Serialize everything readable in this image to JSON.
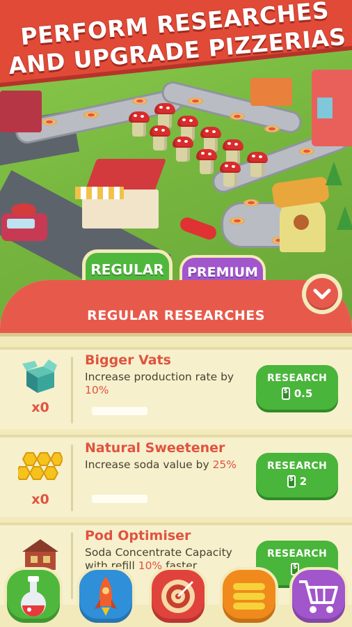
{
  "banner": {
    "line1": "PERFORM RESEARCHES",
    "line2": "AND UPGRADE PIZZERIAS"
  },
  "tabs": [
    {
      "label": "REGULAR",
      "color": "#4fb83c",
      "active": true
    },
    {
      "label": "PREMIUM",
      "color": "#a156cc",
      "active": false
    }
  ],
  "panel": {
    "title": "REGULAR RESEARCHES",
    "header_color": "#e75a4b"
  },
  "researches": [
    {
      "name": "Bigger Vats",
      "desc_pre": "Increase production rate by",
      "desc_value": "10%",
      "desc_post": "",
      "count": "x0",
      "button": "RESEARCH",
      "cost": "0.5",
      "icon": "box-icon"
    },
    {
      "name": "Natural Sweetener",
      "desc_pre": "Increase soda value by",
      "desc_value": "25%",
      "desc_post": "",
      "count": "x0",
      "button": "RESEARCH",
      "cost": "2",
      "icon": "honeycomb-icon"
    },
    {
      "name": "Pod Optimiser",
      "desc_pre": "Soda Concentrate Capacity with refill",
      "desc_value": "10%",
      "desc_post": "faster",
      "count": "",
      "button": "RESEARCH",
      "cost": "",
      "icon": "building-icon"
    }
  ],
  "nav": [
    {
      "icon": "flask-icon",
      "color": "#4fb83c"
    },
    {
      "icon": "rocket-icon",
      "color": "#2f8fd8"
    },
    {
      "icon": "target-icon",
      "color": "#e0433c"
    },
    {
      "icon": "menu-icon",
      "color": "#f08a1c"
    },
    {
      "icon": "shop-cart-icon",
      "color": "#a156cc"
    }
  ],
  "colors": {
    "accent_red": "#e0533f",
    "panel_bg": "#f3eabb",
    "button_green": "#49b53a"
  }
}
